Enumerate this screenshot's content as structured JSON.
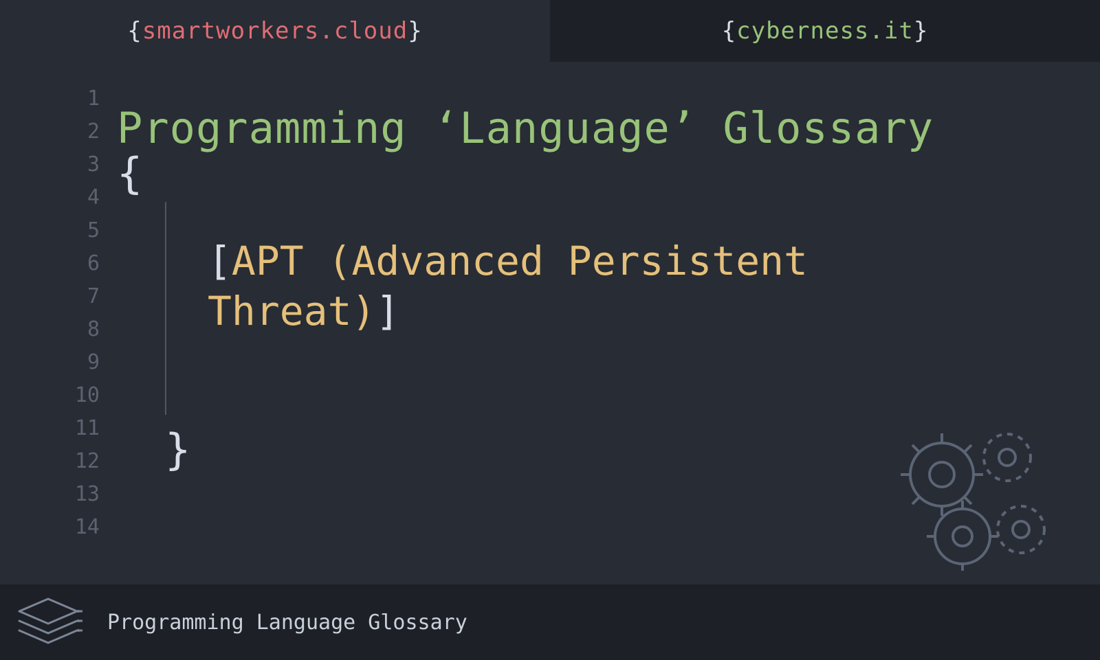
{
  "tabs": {
    "left": {
      "domain": "smartworkers.cloud",
      "open": "{",
      "close": "}"
    },
    "right": {
      "domain": "cyberness.it",
      "open": "{",
      "close": "}"
    }
  },
  "editor": {
    "line_numbers": [
      "1",
      "2",
      "3",
      "4",
      "5",
      "6",
      "7",
      "8",
      "9",
      "10",
      "11",
      "12",
      "13",
      "14"
    ],
    "title": "Programming ‘Language’ Glossary",
    "open_brace": "{",
    "close_brace": "}",
    "bracket_open": "[",
    "bracket_close": "]",
    "term": "APT (Advanced Persistent Threat)"
  },
  "footer": {
    "label": "Programming Language Glossary"
  },
  "icons": {
    "gears": "gears-icon",
    "layers": "layers-icon"
  }
}
